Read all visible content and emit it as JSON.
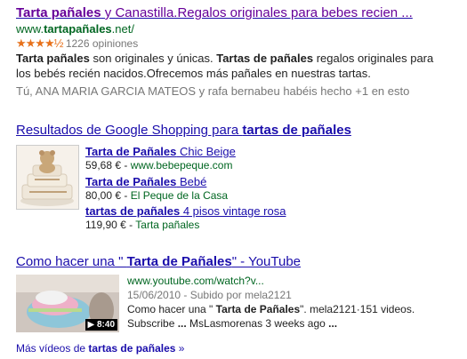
{
  "result1": {
    "title_bold": "Tarta pañales",
    "title_rest": " y Canastilla.Regalos originales para bebes recien ...",
    "url_pre": "www.",
    "url_bold": "tartapañales",
    "url_post": ".net/",
    "rating_stars": "★★★★½",
    "reviews": "1226 opiniones",
    "snippet_b1": "Tarta pañales",
    "snippet_t1": " son originales y únicas. ",
    "snippet_b2": "Tartas de pañales",
    "snippet_t2": " regalos originales para",
    "snippet_line2": "los bebés recién nacidos.Ofrecemos más pañales en nuestras tartas.",
    "social": "Tú, ANA MARIA GARCIA MATEOS y rafa bernabeu habéis hecho +1 en esto"
  },
  "shopping": {
    "header_pre": "Resultados de Google Shopping para ",
    "header_bold": "tartas de pañales",
    "items": [
      {
        "name_bold": "Tarta de Pañales",
        "name_rest": " Chic Beige",
        "price": "59,68 € - ",
        "store": "www.bebepeque.com"
      },
      {
        "name_bold": "Tarta de Pañales",
        "name_rest": " Bebé",
        "price": "80,00 € - ",
        "store": "El Peque de la Casa"
      },
      {
        "name_bold": "tartas de pañales",
        "name_rest": " 4 pisos vintage rosa",
        "price": "119,90 € - ",
        "store": "Tarta pañales"
      }
    ]
  },
  "video": {
    "title_pre": "Como hacer una \" ",
    "title_bold": "Tarta de Pañales",
    "title_post": "\" - YouTube",
    "url": "www.youtube.com/watch?v...",
    "date_line": "15/06/2010 - Subido por mela2121",
    "desc1_pre": "Como hacer una \" ",
    "desc1_bold": "Tarta de Pañales",
    "desc1_post": "\". mela2121·151 videos.",
    "desc2_pre": "Subscribe ",
    "desc2_bold": "...",
    "desc2_post": " MsLasmorenas 3 weeks ago ",
    "desc2_end": "...",
    "duration": "▶ 8:40"
  },
  "more_videos": {
    "pre": "Más vídeos de ",
    "bold": "tartas de pañales",
    "post": " »"
  }
}
